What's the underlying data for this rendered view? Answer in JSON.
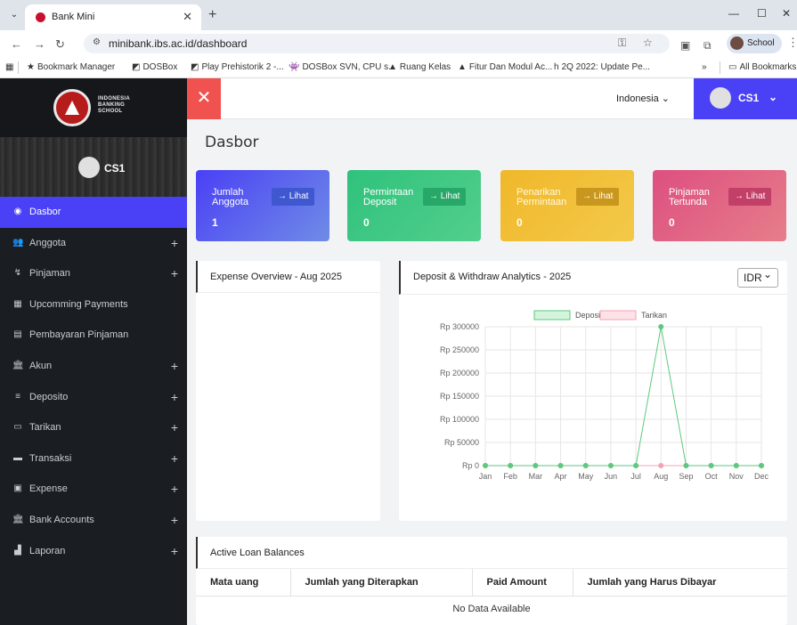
{
  "browser": {
    "tab_title": "Bank Mini",
    "url": "minibank.ibs.ac.id/dashboard",
    "profile_label": "School",
    "bookmarks": [
      "Bookmark Manager",
      "DOSBox",
      "Play Prehistorik 2 -...",
      "DOSBox SVN, CPU s...",
      "Ruang Kelas",
      "Fitur Dan Modul Ac...",
      "2Q 2022: Update Pe..."
    ],
    "all_bookmarks": "All Bookmarks"
  },
  "brand": {
    "line1": "INDONESIA",
    "line2": "BANKING",
    "line3": "SCHOOL"
  },
  "user": {
    "name": "CS1"
  },
  "sidebar": {
    "items": [
      {
        "label": "Dasbor",
        "icon": "dashboard-icon",
        "glyph": "◉",
        "expandable": false,
        "active": true
      },
      {
        "label": "Anggota",
        "icon": "users-icon",
        "glyph": "👥",
        "expandable": true,
        "active": false
      },
      {
        "label": "Pinjaman",
        "icon": "hand-money-icon",
        "glyph": "↯",
        "expandable": true,
        "active": false
      },
      {
        "label": "Upcomming Payments",
        "icon": "calendar-icon",
        "glyph": "▦",
        "expandable": false,
        "active": false
      },
      {
        "label": "Pembayaran Pinjaman",
        "icon": "document-icon",
        "glyph": "▤",
        "expandable": false,
        "active": false
      },
      {
        "label": "Akun",
        "icon": "bank-icon",
        "glyph": "🏛",
        "expandable": true,
        "active": false
      },
      {
        "label": "Deposito",
        "icon": "coins-icon",
        "glyph": "≡",
        "expandable": true,
        "active": false
      },
      {
        "label": "Tarikan",
        "icon": "credit-card-icon",
        "glyph": "▭",
        "expandable": true,
        "active": false
      },
      {
        "label": "Transaksi",
        "icon": "folder-icon",
        "glyph": "▬",
        "expandable": true,
        "active": false
      },
      {
        "label": "Expense",
        "icon": "money-bill-icon",
        "glyph": "▣",
        "expandable": true,
        "active": false
      },
      {
        "label": "Bank Accounts",
        "icon": "bank-icon",
        "glyph": "🏛",
        "expandable": true,
        "active": false
      },
      {
        "label": "Laporan",
        "icon": "bar-chart-icon",
        "glyph": "▟",
        "expandable": true,
        "active": false
      }
    ]
  },
  "topbar": {
    "close_glyph": "✕",
    "language": "Indonesia"
  },
  "page": {
    "title": "Dasbor"
  },
  "stats": [
    {
      "label": "Jumlah Anggota",
      "value": "1",
      "button": "→ Lihat"
    },
    {
      "label": "Permintaan Deposit",
      "value": "0",
      "button": "→ Lihat"
    },
    {
      "label": "Penarikan Permintaan",
      "value": "0",
      "button": "→ Lihat"
    },
    {
      "label": "Pinjaman Tertunda",
      "value": "0",
      "button": "→ Lihat"
    }
  ],
  "expense_card": {
    "title": "Expense Overview - Aug 2025"
  },
  "deposit_card": {
    "title": "Deposit & Withdraw Analytics - 2025",
    "currency": "IDR"
  },
  "chart_data": {
    "type": "line",
    "categories": [
      "Jan",
      "Feb",
      "Mar",
      "Apr",
      "May",
      "Jun",
      "Jul",
      "Aug",
      "Sep",
      "Oct",
      "Nov",
      "Dec"
    ],
    "series": [
      {
        "name": "Deposito",
        "values": [
          0,
          0,
          0,
          0,
          0,
          0,
          0,
          300000,
          0,
          0,
          0,
          0
        ],
        "color": "#5cc97e",
        "fill": "#d4f3dd"
      },
      {
        "name": "Tarikan",
        "values": [
          0,
          0,
          0,
          0,
          0,
          0,
          0,
          0,
          0,
          0,
          0,
          0
        ],
        "color": "#f4a3b4",
        "fill": "#fde2e8"
      }
    ],
    "yticks": [
      "Rp 0",
      "Rp 50000",
      "Rp 100000",
      "Rp 150000",
      "Rp 200000",
      "Rp 250000",
      "Rp 300000"
    ],
    "ylim": [
      0,
      300000
    ],
    "grid": true,
    "legend": "top-center"
  },
  "loans_card": {
    "title": "Active Loan Balances",
    "columns": [
      "Mata uang",
      "Jumlah yang Diterapkan",
      "Paid Amount",
      "Jumlah yang Harus Dibayar"
    ],
    "empty_text": "No Data Available"
  }
}
